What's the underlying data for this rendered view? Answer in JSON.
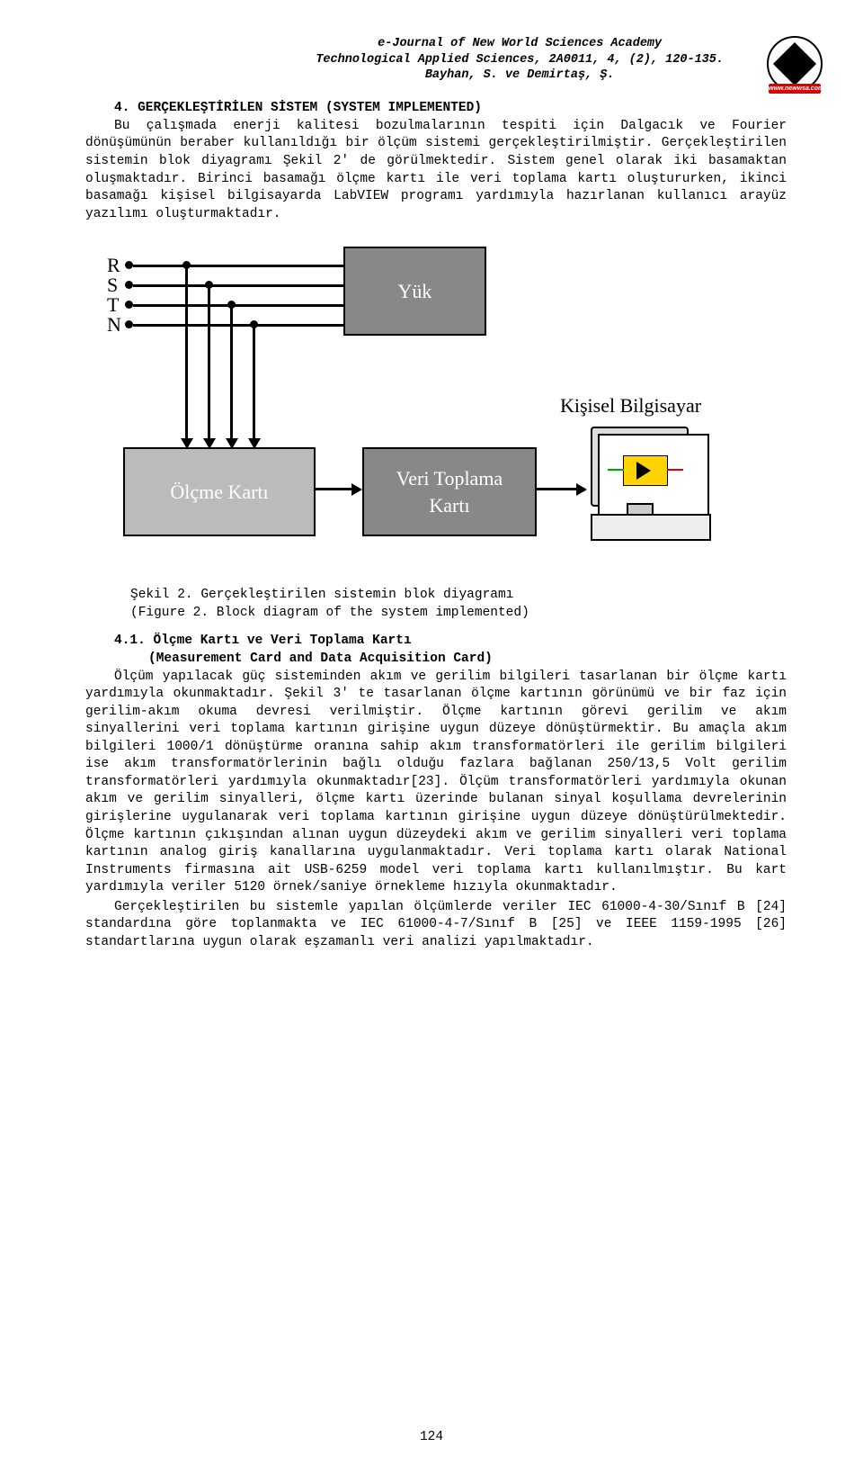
{
  "header": {
    "line1": "e-Journal of New World Sciences Academy",
    "line2": "Technological Applied Sciences, 2A0011, 4, (2), 120-135.",
    "line3": "Bayhan, S. ve Demirtaş, Ş.",
    "logo_band": "www.newwsa.com"
  },
  "section4": {
    "title": "4. GERÇEKLEŞTİRİLEN SİSTEM (SYSTEM IMPLEMENTED)",
    "p1": "Bu çalışmada enerji kalitesi bozulmalarının tespiti için Dalgacık ve Fourier dönüşümünün beraber kullanıldığı bir ölçüm sistemi gerçekleştirilmiştir. Gerçekleştirilen sistemin blok diyagramı Şekil 2' de görülmektedir. Sistem genel olarak iki basamaktan oluşmaktadır. Birinci basamağı ölçme kartı ile veri toplama kartı oluştururken, ikinci basamağı kişisel bilgisayarda LabVIEW programı yardımıyla hazırlanan kullanıcı arayüz yazılımı oluşturmaktadır."
  },
  "diagram": {
    "wire_labels": [
      "R",
      "S",
      "T",
      "N"
    ],
    "yuk": "Yük",
    "olcme": "Ölçme Kartı",
    "veri": "Veri Toplama\nKartı",
    "pc_label": "Kişisel Bilgisayar"
  },
  "fig_caption": {
    "l1": "Şekil 2. Gerçekleştirilen sistemin blok diyagramı",
    "l2": "(Figure 2. Block diagram of the system implemented)"
  },
  "subsection41": {
    "title": "4.1. Ölçme Kartı ve Veri Toplama Kartı",
    "subtitle": "(Measurement Card and Data Acquisition Card)",
    "p1": "Ölçüm yapılacak güç sisteminden akım ve gerilim bilgileri tasarlanan bir ölçme kartı yardımıyla okunmaktadır. Şekil 3' te tasarlanan ölçme kartının görünümü ve bir faz için gerilim-akım okuma devresi verilmiştir. Ölçme kartının görevi gerilim ve akım sinyallerini veri toplama kartının girişine uygun düzeye dönüştürmektir. Bu amaçla akım bilgileri 1000/1 dönüştürme oranına sahip akım transformatörleri ile gerilim bilgileri ise akım transformatörlerinin bağlı olduğu fazlara bağlanan 250/13,5 Volt gerilim transformatörleri yardımıyla okunmaktadır[23]. Ölçüm transformatörleri yardımıyla okunan akım ve gerilim sinyalleri, ölçme kartı üzerinde bulanan sinyal koşullama devrelerinin girişlerine uygulanarak veri toplama kartının girişine uygun düzeye dönüştürülmektedir. Ölçme kartının çıkışından alınan uygun düzeydeki akım ve gerilim sinyalleri veri toplama kartının analog giriş kanallarına uygulanmaktadır. Veri toplama kartı olarak National Instruments firmasına ait USB-6259 model veri toplama kartı kullanılmıştır. Bu kart yardımıyla veriler 5120 örnek/saniye örnekleme hızıyla okunmaktadır.",
    "p2": "Gerçekleştirilen bu sistemle yapılan ölçümlerde veriler IEC 61000-4-30/Sınıf B [24] standardına göre toplanmakta ve IEC 61000-4-7/Sınıf B [25] ve IEEE 1159-1995 [26] standartlarına uygun olarak eşzamanlı veri analizi yapılmaktadır."
  },
  "page_number": "124"
}
